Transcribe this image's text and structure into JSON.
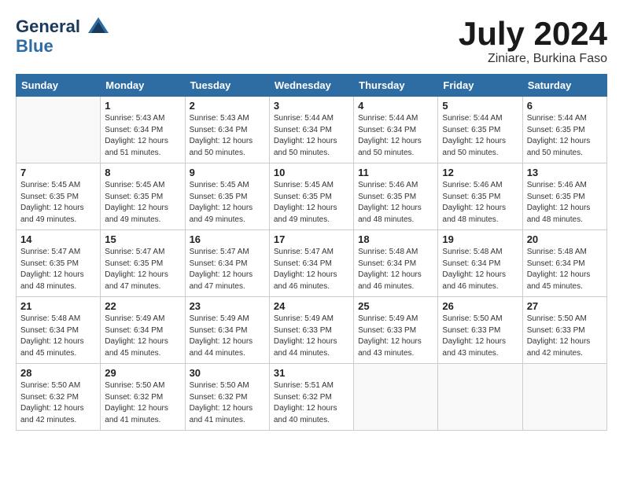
{
  "header": {
    "logo_line1": "General",
    "logo_line2": "Blue",
    "month_title": "July 2024",
    "location": "Ziniare, Burkina Faso"
  },
  "weekdays": [
    "Sunday",
    "Monday",
    "Tuesday",
    "Wednesday",
    "Thursday",
    "Friday",
    "Saturday"
  ],
  "weeks": [
    [
      {
        "day": "",
        "info": ""
      },
      {
        "day": "1",
        "info": "Sunrise: 5:43 AM\nSunset: 6:34 PM\nDaylight: 12 hours\nand 51 minutes."
      },
      {
        "day": "2",
        "info": "Sunrise: 5:43 AM\nSunset: 6:34 PM\nDaylight: 12 hours\nand 50 minutes."
      },
      {
        "day": "3",
        "info": "Sunrise: 5:44 AM\nSunset: 6:34 PM\nDaylight: 12 hours\nand 50 minutes."
      },
      {
        "day": "4",
        "info": "Sunrise: 5:44 AM\nSunset: 6:34 PM\nDaylight: 12 hours\nand 50 minutes."
      },
      {
        "day": "5",
        "info": "Sunrise: 5:44 AM\nSunset: 6:35 PM\nDaylight: 12 hours\nand 50 minutes."
      },
      {
        "day": "6",
        "info": "Sunrise: 5:44 AM\nSunset: 6:35 PM\nDaylight: 12 hours\nand 50 minutes."
      }
    ],
    [
      {
        "day": "7",
        "info": "Sunrise: 5:45 AM\nSunset: 6:35 PM\nDaylight: 12 hours\nand 49 minutes."
      },
      {
        "day": "8",
        "info": "Sunrise: 5:45 AM\nSunset: 6:35 PM\nDaylight: 12 hours\nand 49 minutes."
      },
      {
        "day": "9",
        "info": "Sunrise: 5:45 AM\nSunset: 6:35 PM\nDaylight: 12 hours\nand 49 minutes."
      },
      {
        "day": "10",
        "info": "Sunrise: 5:45 AM\nSunset: 6:35 PM\nDaylight: 12 hours\nand 49 minutes."
      },
      {
        "day": "11",
        "info": "Sunrise: 5:46 AM\nSunset: 6:35 PM\nDaylight: 12 hours\nand 48 minutes."
      },
      {
        "day": "12",
        "info": "Sunrise: 5:46 AM\nSunset: 6:35 PM\nDaylight: 12 hours\nand 48 minutes."
      },
      {
        "day": "13",
        "info": "Sunrise: 5:46 AM\nSunset: 6:35 PM\nDaylight: 12 hours\nand 48 minutes."
      }
    ],
    [
      {
        "day": "14",
        "info": "Sunrise: 5:47 AM\nSunset: 6:35 PM\nDaylight: 12 hours\nand 48 minutes."
      },
      {
        "day": "15",
        "info": "Sunrise: 5:47 AM\nSunset: 6:35 PM\nDaylight: 12 hours\nand 47 minutes."
      },
      {
        "day": "16",
        "info": "Sunrise: 5:47 AM\nSunset: 6:34 PM\nDaylight: 12 hours\nand 47 minutes."
      },
      {
        "day": "17",
        "info": "Sunrise: 5:47 AM\nSunset: 6:34 PM\nDaylight: 12 hours\nand 46 minutes."
      },
      {
        "day": "18",
        "info": "Sunrise: 5:48 AM\nSunset: 6:34 PM\nDaylight: 12 hours\nand 46 minutes."
      },
      {
        "day": "19",
        "info": "Sunrise: 5:48 AM\nSunset: 6:34 PM\nDaylight: 12 hours\nand 46 minutes."
      },
      {
        "day": "20",
        "info": "Sunrise: 5:48 AM\nSunset: 6:34 PM\nDaylight: 12 hours\nand 45 minutes."
      }
    ],
    [
      {
        "day": "21",
        "info": "Sunrise: 5:48 AM\nSunset: 6:34 PM\nDaylight: 12 hours\nand 45 minutes."
      },
      {
        "day": "22",
        "info": "Sunrise: 5:49 AM\nSunset: 6:34 PM\nDaylight: 12 hours\nand 45 minutes."
      },
      {
        "day": "23",
        "info": "Sunrise: 5:49 AM\nSunset: 6:34 PM\nDaylight: 12 hours\nand 44 minutes."
      },
      {
        "day": "24",
        "info": "Sunrise: 5:49 AM\nSunset: 6:33 PM\nDaylight: 12 hours\nand 44 minutes."
      },
      {
        "day": "25",
        "info": "Sunrise: 5:49 AM\nSunset: 6:33 PM\nDaylight: 12 hours\nand 43 minutes."
      },
      {
        "day": "26",
        "info": "Sunrise: 5:50 AM\nSunset: 6:33 PM\nDaylight: 12 hours\nand 43 minutes."
      },
      {
        "day": "27",
        "info": "Sunrise: 5:50 AM\nSunset: 6:33 PM\nDaylight: 12 hours\nand 42 minutes."
      }
    ],
    [
      {
        "day": "28",
        "info": "Sunrise: 5:50 AM\nSunset: 6:32 PM\nDaylight: 12 hours\nand 42 minutes."
      },
      {
        "day": "29",
        "info": "Sunrise: 5:50 AM\nSunset: 6:32 PM\nDaylight: 12 hours\nand 41 minutes."
      },
      {
        "day": "30",
        "info": "Sunrise: 5:50 AM\nSunset: 6:32 PM\nDaylight: 12 hours\nand 41 minutes."
      },
      {
        "day": "31",
        "info": "Sunrise: 5:51 AM\nSunset: 6:32 PM\nDaylight: 12 hours\nand 40 minutes."
      },
      {
        "day": "",
        "info": ""
      },
      {
        "day": "",
        "info": ""
      },
      {
        "day": "",
        "info": ""
      }
    ]
  ]
}
